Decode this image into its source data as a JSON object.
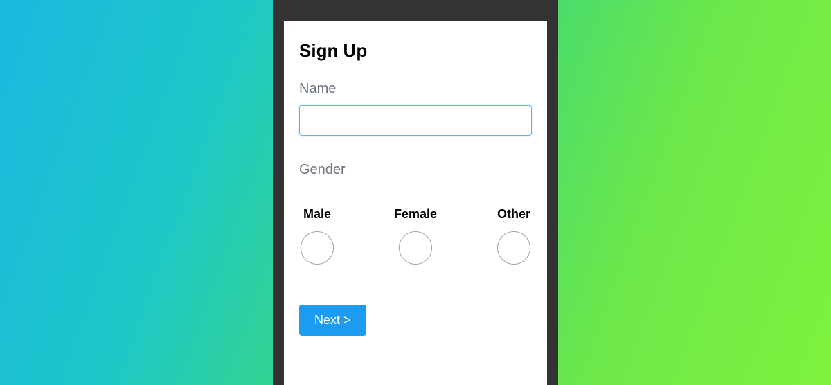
{
  "form": {
    "title": "Sign Up",
    "nameLabel": "Name",
    "nameValue": "",
    "genderLabel": "Gender",
    "options": {
      "male": "Male",
      "female": "Female",
      "other": "Other"
    },
    "nextButton": "Next >"
  }
}
